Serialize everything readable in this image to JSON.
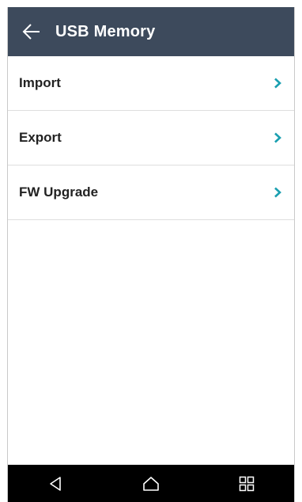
{
  "header": {
    "title": "USB Memory",
    "back_icon": "arrow-left-icon",
    "background_color": "#3d4a5c"
  },
  "menu": {
    "items": [
      {
        "label": "Import",
        "icon": "chevron-right-icon"
      },
      {
        "label": "Export",
        "icon": "chevron-right-icon"
      },
      {
        "label": "FW Upgrade",
        "icon": "chevron-right-icon"
      }
    ],
    "chevron_color": "#1a9fb0"
  },
  "navbar": {
    "buttons": [
      {
        "icon": "back-triangle-icon"
      },
      {
        "icon": "home-icon"
      },
      {
        "icon": "recent-apps-icon"
      }
    ]
  }
}
